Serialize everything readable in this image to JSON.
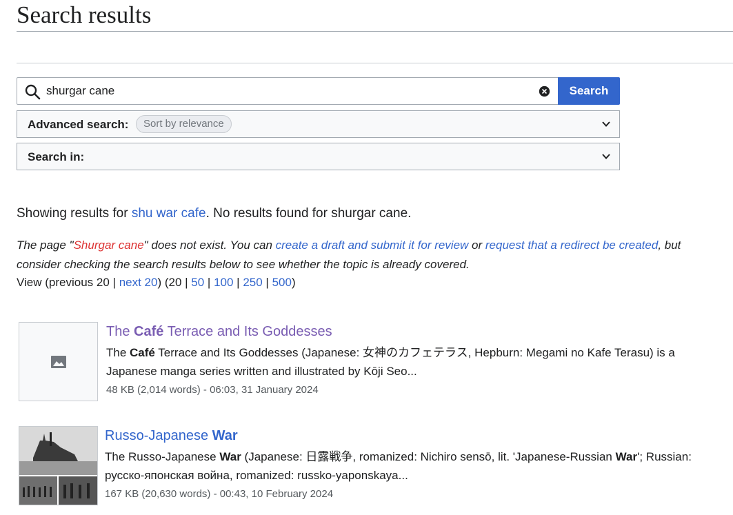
{
  "page": {
    "title": "Search results"
  },
  "search": {
    "query": "shurgar cane",
    "button_label": "Search",
    "clear_icon": "clear-icon",
    "search_icon": "search-icon"
  },
  "advanced": {
    "label": "Advanced search:",
    "chip": "Sort by relevance"
  },
  "search_in": {
    "label": "Search in:"
  },
  "showing": {
    "prefix": "Showing results for ",
    "suggestion": "shu war cafe",
    "suffix": ". No results found for shurgar cane."
  },
  "notice": {
    "p1": "The page \"",
    "missing_title": "Shurgar cane",
    "p2": "\" does not exist. You can ",
    "link1": "create a draft and submit it for review",
    "p3": " or ",
    "link2": "request that a redirect be created",
    "p4": ", but consider checking the search results below to see whether the topic is already covered."
  },
  "paging": {
    "view_prefix": "View (previous 20 | ",
    "next_label": "next 20",
    "mid": ") (20 | ",
    "sizes": [
      "50",
      "100",
      "250",
      "500"
    ],
    "sep": " | ",
    "close": ")"
  },
  "results": [
    {
      "title_pre": "The ",
      "title_bold": "Café",
      "title_post": " Terrace and Its Goddesses",
      "snippet_pre": "The ",
      "snippet_bold": "Café",
      "snippet_post": " Terrace and Its Goddesses (Japanese: 女神のカフェテラス, Hepburn: Megami no Kafe Terasu) is a Japanese manga series written and illustrated by Kōji Seo...",
      "meta": "48 KB (2,014 words) - 06:03, 31 January 2024",
      "thumb_icon": "image-placeholder-icon"
    },
    {
      "title_pre": "Russo-Japanese ",
      "title_bold": "War",
      "title_post": "",
      "snippet_pre": "The Russo-Japanese ",
      "snippet_bold": "War",
      "snippet_mid": " (Japanese: 日露戦争, romanized: Nichiro sensō, lit. 'Japanese-Russian ",
      "snippet_bold2": "War",
      "snippet_post": "'; Russian: русско-японская война, romanized: russko-yaponskaya...",
      "meta": "167 KB (20,630 words) - 00:43, 10 February 2024"
    }
  ],
  "colors": {
    "link": "#3366cc",
    "visited": "#795cb2",
    "redlink": "#dd3333",
    "button": "#3366cc"
  }
}
